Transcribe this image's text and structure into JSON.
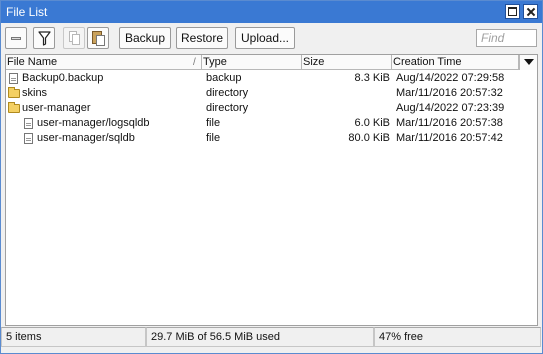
{
  "window": {
    "title": "File List"
  },
  "toolbar": {
    "backup_label": "Backup",
    "restore_label": "Restore",
    "upload_label": "Upload...",
    "find_placeholder": "Find"
  },
  "table": {
    "columns": [
      "File Name",
      "Type",
      "Size",
      "Creation Time"
    ],
    "sort_indicator": "/",
    "rows": [
      {
        "name": "Backup0.backup",
        "type": "backup",
        "size": "8.3 KiB",
        "created": "Aug/14/2022 07:29:58",
        "icon": "file-icon"
      },
      {
        "name": "skins",
        "type": "directory",
        "size": "",
        "created": "Mar/11/2016 20:57:32",
        "icon": "folder-icon"
      },
      {
        "name": "user-manager",
        "type": "directory",
        "size": "",
        "created": "Aug/14/2022 07:23:39",
        "icon": "folder-icon"
      },
      {
        "name": "user-manager/logsqldb",
        "type": "file",
        "size": "6.0 KiB",
        "created": "Mar/11/2016 20:57:38",
        "icon": "file-icon"
      },
      {
        "name": "user-manager/sqldb",
        "type": "file",
        "size": "80.0 KiB",
        "created": "Mar/11/2016 20:57:42",
        "icon": "file-icon"
      }
    ]
  },
  "status": {
    "items": "5 items",
    "disk_used": "29.7 MiB of 56.5 MiB used",
    "free": "47% free"
  },
  "colors": {
    "titlebar": "#3a79d3",
    "window_bg": "#f0f0f0",
    "list_bg": "#ffffff"
  }
}
